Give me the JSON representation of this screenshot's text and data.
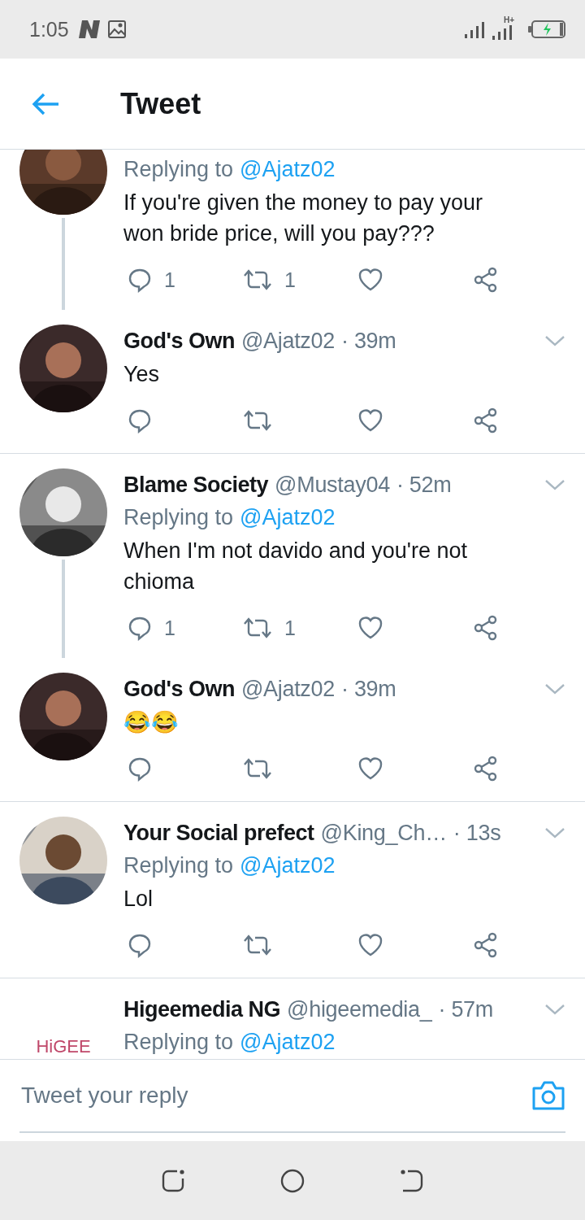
{
  "status_bar": {
    "time": "1:05",
    "network": "H+"
  },
  "header": {
    "title": "Tweet"
  },
  "tweets": [
    {
      "replying_to": {
        "label": "Replying to",
        "handle": "@Ajatz02"
      },
      "text": "If you're given the money to pay your won bride price, will you pay???",
      "reply_count": "1",
      "retweet_count": "1",
      "thread_line": true
    },
    {
      "name": "God's Own",
      "handle": "@Ajatz02",
      "time": "· 39m",
      "text": "Yes",
      "thread_line": false
    },
    {
      "name": "Blame Society",
      "handle": "@Mustay04",
      "time": "· 52m",
      "replying_to": {
        "label": "Replying to",
        "handle": "@Ajatz02"
      },
      "text": "When I'm not davido and you're not chioma",
      "reply_count": "1",
      "retweet_count": "1",
      "thread_line": true
    },
    {
      "name": "God's Own",
      "handle": "@Ajatz02",
      "time": "· 39m",
      "text": "😂😂",
      "thread_line": false
    },
    {
      "name": "Your Social prefect",
      "handle": "@King_Ch…",
      "time": "· 13s",
      "replying_to": {
        "label": "Replying to",
        "handle": "@Ajatz02"
      },
      "text": "Lol",
      "thread_line": false
    },
    {
      "name": "Higeemedia NG",
      "handle": "@higeemedia_",
      "time": "· 57m",
      "avatar": {
        "kind": "logo",
        "text": "HiGEE"
      },
      "replying_to": {
        "label": "Replying to",
        "handle": "@Ajatz02"
      },
      "thread_line": false
    }
  ],
  "reply_bar": {
    "placeholder": "Tweet your reply"
  }
}
